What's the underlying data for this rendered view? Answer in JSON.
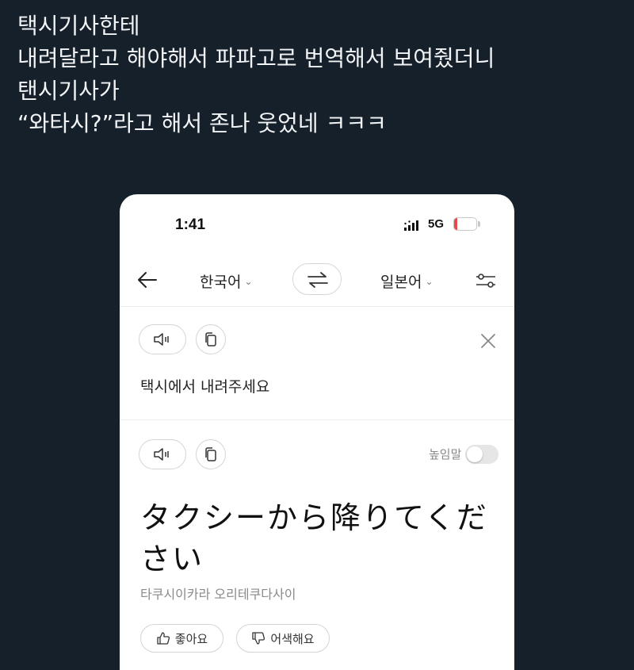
{
  "tweet": {
    "lines": [
      "택시기사한테",
      "내려달라고 해야해서 파파고로 번역해서 보여줬더니",
      "탠시기사가",
      "“와타시?”라고 해서 존나 웃었네 ㅋㅋㅋ"
    ]
  },
  "status_bar": {
    "time": "1:41",
    "network": "5G",
    "battery": "15",
    "battery_level_percent": 15
  },
  "toolbar": {
    "source_lang": "한국어",
    "target_lang": "일본어",
    "icons": {
      "back": "arrow-left-icon",
      "swap": "swap-arrows-icon",
      "settings": "sliders-icon"
    }
  },
  "source": {
    "text": "택시에서 내려주세요",
    "icons": [
      "speaker-icon",
      "copy-icon",
      "close-icon"
    ]
  },
  "result": {
    "honorific_label": "높임말",
    "honorific_on": false,
    "translation": "タクシーから降りてください",
    "pronunciation": "타쿠시이카라 오리테쿠다사이",
    "like_label": "좋아요",
    "dislike_label": "어색해요"
  },
  "colors": {
    "background": "#15202b",
    "tweet_text": "#f2f4f6",
    "battery_low": "#e5484d"
  }
}
